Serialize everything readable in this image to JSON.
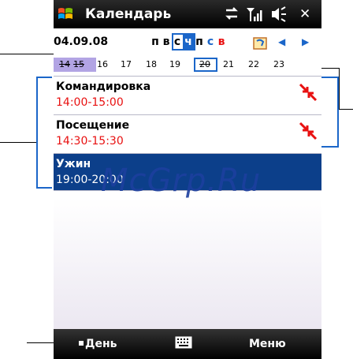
{
  "titlebar": {
    "title": "Календарь",
    "icons": [
      "windows-logo-icon",
      "sync-icon",
      "signal-icon",
      "volume-icon",
      "close-icon"
    ],
    "close_glyph": "✕"
  },
  "toolbar": {
    "current_date": "04.09.08",
    "weekdays": [
      {
        "label": "п",
        "color": "#000000"
      },
      {
        "label": "в",
        "color": "#000000"
      },
      {
        "label": "с",
        "color": "#000000"
      },
      {
        "label": "ч",
        "color": "#ffffff"
      },
      {
        "label": "п",
        "color": "#000000"
      },
      {
        "label": "с",
        "color": "#1b66c9"
      },
      {
        "label": "в",
        "color": "#e81010"
      }
    ],
    "view_icon": "calendar-view-icon",
    "prev_icon": "◀",
    "next_icon": "▶"
  },
  "week": {
    "days": [
      "14",
      "15",
      "16",
      "17",
      "18",
      "19",
      "20",
      "21",
      "22",
      "23"
    ]
  },
  "appointments": [
    {
      "title": "Командировка",
      "time": "14:00-15:00",
      "conflict": true,
      "selected": false
    },
    {
      "title": "Посещение",
      "time": "14:30-15:30",
      "conflict": true,
      "selected": false
    },
    {
      "title": "Ужин",
      "time": "19:00-20:00",
      "conflict": false,
      "selected": true
    }
  ],
  "menubar": {
    "left": "День",
    "right": "Меню"
  },
  "watermark": "McGrp.Ru",
  "colors": {
    "accent": "#1b66c9",
    "selected_bg": "#0c3f8a",
    "time_red": "#e81010"
  }
}
